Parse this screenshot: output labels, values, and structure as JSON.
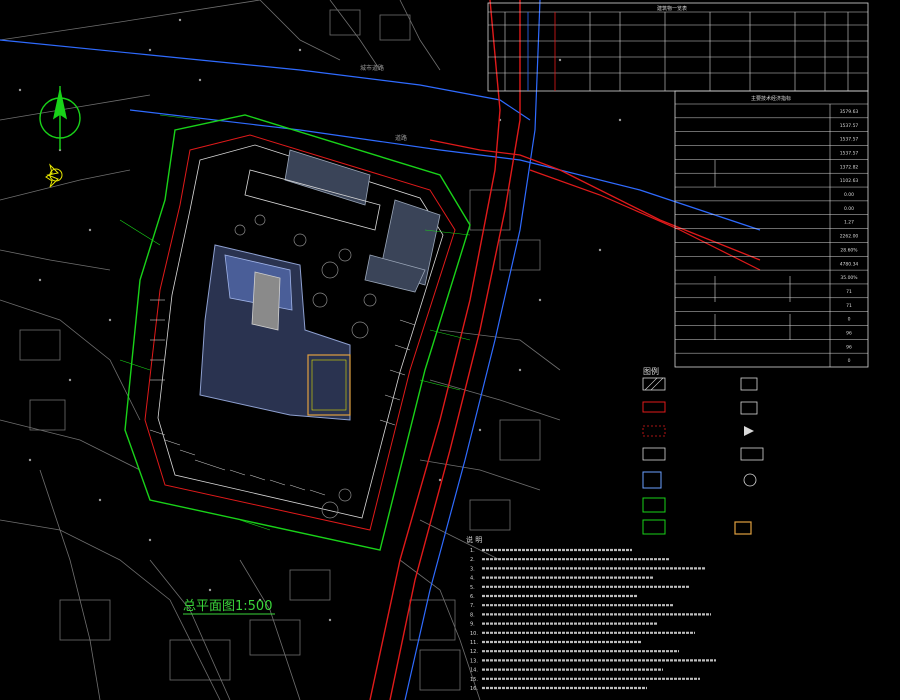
{
  "colors": {
    "background": "#000000",
    "site_boundary": "#19d219",
    "road_red": "#e01a1a",
    "road_blue": "#2f6bff",
    "cad_white": "#d8d8d8",
    "cad_grey": "#7a7a7a",
    "building_hatch": "#7a8aa0",
    "courtyard_blue": "#6a7fb8",
    "legend_orange": "#e0a040",
    "title_text": "#3ad43a"
  },
  "north_arrow_icon": "north-arrow-icon",
  "drawing_title": "总平面图1:500",
  "scale_small_label": "1:500",
  "tables": {
    "schedule_header": "建筑物一览表",
    "indicators_header": "主要技术经济指标",
    "indicator_values": [
      "3579.63",
      "1537.57",
      "1537.57",
      "1537.57",
      "1372.82",
      "1102.63",
      "0.00",
      "0.00",
      "1.27",
      "2262.00",
      "28.60%",
      "4780.34",
      "35.00%",
      "71",
      "71",
      "0",
      "96",
      "96",
      "0"
    ]
  },
  "legend": {
    "title": "图例"
  },
  "notes": {
    "title": "说 明",
    "numbers": [
      "1.",
      "2.",
      "3.",
      "4.",
      "5.",
      "6.",
      "7.",
      "8.",
      "9.",
      "10.",
      "11.",
      "12.",
      "13.",
      "14.",
      "15.",
      "16."
    ]
  },
  "road_labels": [
    "城市道路",
    "道路"
  ]
}
